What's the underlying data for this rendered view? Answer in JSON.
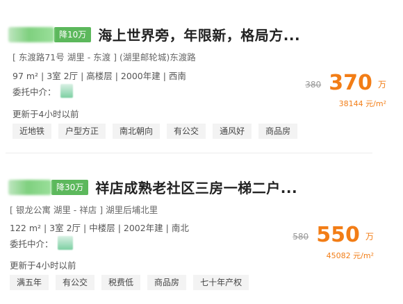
{
  "listings": [
    {
      "price_drop": "降10万",
      "title": "海上世界旁，年限新，格局方...",
      "address": "[ 东渡路71号 湖里 - 东渡 ] (湖里邮轮城)东渡路",
      "specs": "97 m² | 3室 2厅 | 高楼层 | 2000年建 | 西南",
      "agent_label": "委托中介：",
      "updated": "更新于4小时以前",
      "tags": [
        "近地铁",
        "户型方正",
        "南北朝向",
        "有公交",
        "通风好",
        "商品房"
      ],
      "old_price": "380",
      "price": "370",
      "price_unit": "万",
      "unit_price": "38144 元/m²"
    },
    {
      "price_drop": "降30万",
      "title": "祥店成熟老社区三房一梯二户...",
      "address": "[ 银龙公寓 湖里 - 祥店 ] 湖里后埔北里",
      "specs": "122 m² | 3室 2厅 | 中楼层 | 2002年建 | 南北",
      "agent_label": "委托中介：",
      "updated": "更新于4小时以前",
      "tags": [
        "满五年",
        "有公交",
        "税费低",
        "商品房",
        "七十年产权"
      ],
      "old_price": "580",
      "price": "550",
      "price_unit": "万",
      "unit_price": "45082 元/m²"
    }
  ]
}
